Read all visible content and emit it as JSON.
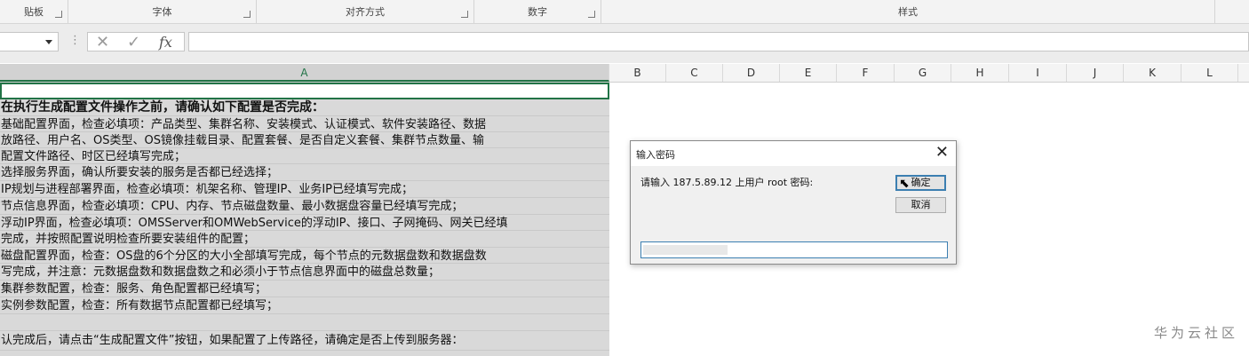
{
  "ribbon": {
    "groups": [
      "贴板",
      "字体",
      "对齐方式",
      "数字",
      "样式"
    ]
  },
  "formula_bar": {
    "cancel_glyph": "✕",
    "enter_glyph": "✓",
    "fx_label": "fx",
    "dots": "⋮",
    "formula_value": ""
  },
  "columns": [
    "A",
    "B",
    "C",
    "D",
    "E",
    "F",
    "G",
    "H",
    "I",
    "J",
    "K",
    "L"
  ],
  "sheet": {
    "rows": [
      "在执行生成配置文件操作之前，请确认如下配置是否完成：",
      "基础配置界面，检查必填项：产品类型、集群名称、安装模式、认证模式、软件安装路径、数据",
      "放路径、用户名、OS类型、OS镜像挂载目录、配置套餐、是否自定义套餐、集群节点数量、输",
      "配置文件路径、时区已经填写完成；",
      "选择服务界面，确认所要安装的服务是否都已经选择；",
      "IP规划与进程部署界面，检查必填项：机架名称、管理IP、业务IP已经填写完成；",
      "节点信息界面，检查必填项：CPU、内存、节点磁盘数量、最小数据盘容量已经填写完成；",
      "浮动IP界面，检查必填项：OMSServer和OMWebService的浮动IP、接口、子网掩码、网关已经填",
      "完成，并按照配置说明检查所要安装组件的配置；",
      "磁盘配置界面，检查：OS盘的6个分区的大小全部填写完成，每个节点的元数据盘数和数据盘数",
      "写完成，并注意：元数据盘数和数据盘数之和必须小于节点信息界面中的磁盘总数量；",
      "集群参数配置，检查：服务、角色配置都已经填写；",
      "实例参数配置，检查：所有数据节点配置都已经填写；",
      "",
      "认完成后，请点击“生成配置文件”按钮，如果配置了上传路径，请确定是否上传到服务器："
    ]
  },
  "dialog": {
    "title": "输入密码",
    "close_glyph": "✕",
    "prompt": "请输入 187.5.89.12 上用户 root 密码:",
    "ok_label": "确定",
    "cancel_label": "取消",
    "password_value": ""
  },
  "watermark": "华为云社区"
}
